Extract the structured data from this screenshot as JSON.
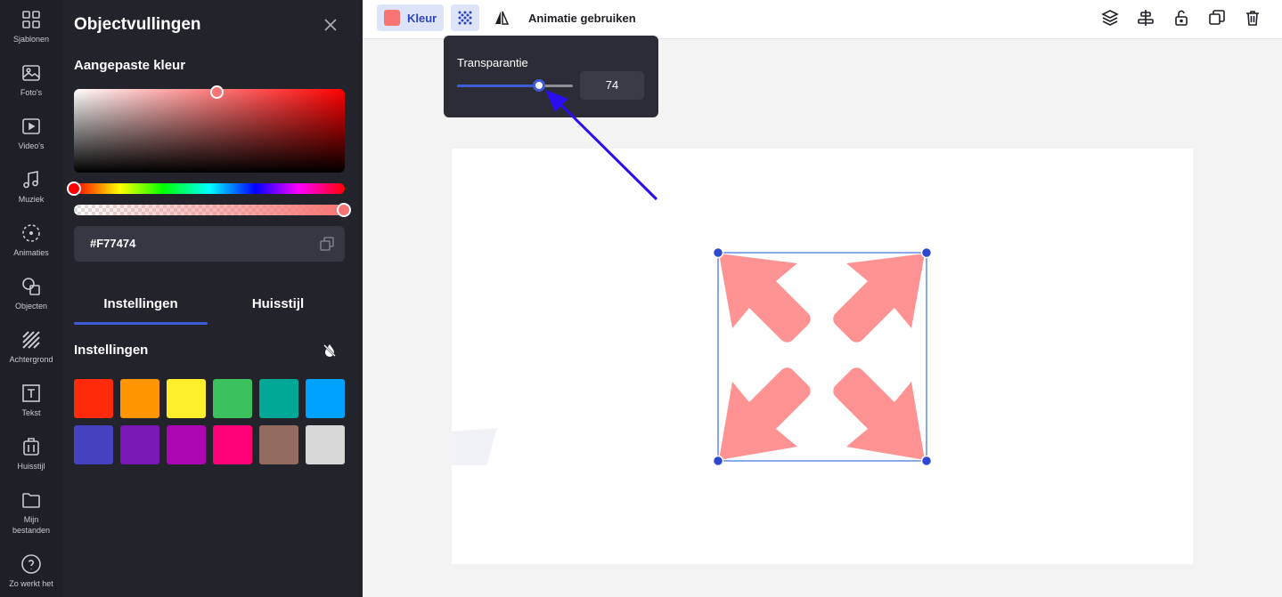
{
  "sidebar": {
    "items": [
      {
        "label": "Sjablonen",
        "icon": "templates-icon"
      },
      {
        "label": "Foto's",
        "icon": "photo-icon"
      },
      {
        "label": "Video's",
        "icon": "video-icon"
      },
      {
        "label": "Muziek",
        "icon": "music-icon"
      },
      {
        "label": "Animaties",
        "icon": "animation-icon"
      },
      {
        "label": "Objecten",
        "icon": "shapes-icon"
      },
      {
        "label": "Achtergrond",
        "icon": "background-icon"
      },
      {
        "label": "Tekst",
        "icon": "text-icon"
      },
      {
        "label": "Huisstijl",
        "icon": "brand-icon"
      },
      {
        "label": "Mijn bestanden",
        "icon": "folder-icon"
      },
      {
        "label": "Zo werkt het",
        "icon": "help-icon"
      }
    ]
  },
  "panel": {
    "title": "Objectvullingen",
    "subtitle": "Aangepaste kleur",
    "hex_value": "#F77474",
    "tabs": [
      {
        "label": "Instellingen",
        "active": true
      },
      {
        "label": "Huisstijl",
        "active": false
      }
    ],
    "section_title": "Instellingen",
    "swatches": [
      "#ff2a0a",
      "#ff9500",
      "#ffee2b",
      "#3cc15f",
      "#00a996",
      "#00a2ff",
      "#4641be",
      "#7a18b6",
      "#ac06b2",
      "#ff0076",
      "#936c60",
      "#d8d8d8"
    ]
  },
  "toolbar": {
    "color_label": "Kleur",
    "color_value": "#f77474",
    "animation_label": "Animatie gebruiken",
    "right_icons": [
      "layers-icon",
      "align-icon",
      "unlock-icon",
      "duplicate-icon",
      "trash-icon"
    ]
  },
  "popup": {
    "label": "Transparantie",
    "value": "74",
    "slider_fraction": 0.74
  },
  "canvas": {
    "shape_color": "#ff9393",
    "selection_color": "#2f48d2"
  }
}
